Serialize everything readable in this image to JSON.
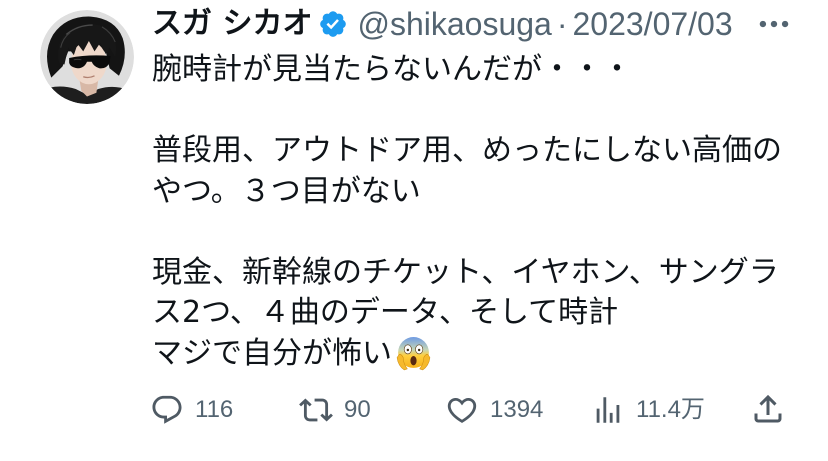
{
  "tweet": {
    "author": {
      "display_name": "スガ シカオ",
      "handle": "@shikaosuga",
      "verified_badge_icon": "verified-badge-icon"
    },
    "separator": "·",
    "date": "2023/07/03",
    "more_icon": "more-icon",
    "paragraphs": [
      [
        "腕時計が見当たらないんだが・・・"
      ],
      [
        "普段用、アウトドア用、めったにしない高価の",
        "やつ。３つ目がない"
      ],
      [
        "現金、新幹線のチケット、イヤホン、サングラ",
        "ス2つ、４曲のデータ、そして時計",
        "マジで自分が怖い"
      ]
    ],
    "emoji_icon": "face-screaming-in-fear-emoji"
  },
  "actions": {
    "reply": {
      "icon": "reply-icon",
      "count": "116"
    },
    "retweet": {
      "icon": "retweet-icon",
      "count": "90"
    },
    "like": {
      "icon": "like-icon",
      "count": "1394"
    },
    "views": {
      "icon": "views-icon",
      "count": "11.4万"
    },
    "share": {
      "icon": "share-icon"
    }
  },
  "colors": {
    "text": "#0f1419",
    "secondary": "#536471",
    "verified": "#1d9bf0",
    "background": "#ffffff"
  }
}
